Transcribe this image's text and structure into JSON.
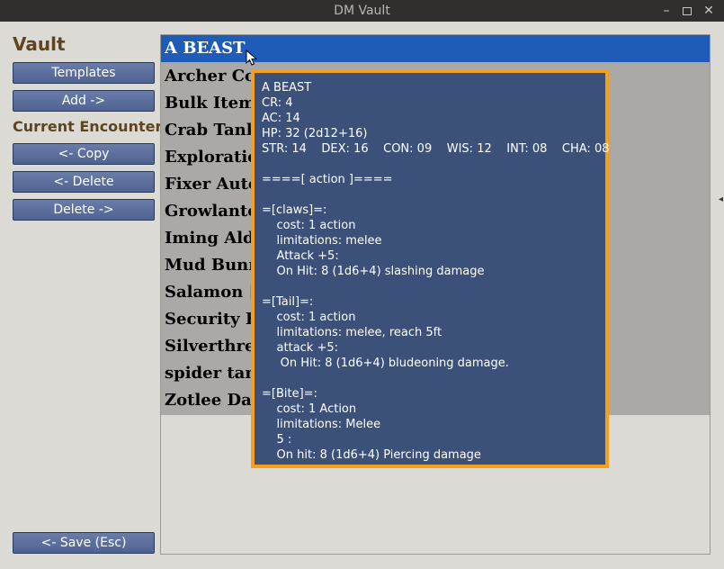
{
  "window": {
    "title": "DM Vault"
  },
  "sidebar": {
    "title": "Vault",
    "templates_label": "Templates",
    "add_label": "Add ->",
    "encounter_title": "Current Encounter",
    "copy_label": "<- Copy",
    "delete_left_label": "<- Delete",
    "delete_right_label": "Delete ->",
    "save_label": "<- Save (Esc)"
  },
  "list": {
    "items": [
      {
        "label": "A BEAST"
      },
      {
        "label": "Archer Co"
      },
      {
        "label": "Bulk Items"
      },
      {
        "label": "Crab Tank"
      },
      {
        "label": "Exploratio"
      },
      {
        "label": "Fixer Auto"
      },
      {
        "label": "Growlante"
      },
      {
        "label": "Iming Alda"
      },
      {
        "label": "Mud Bunn"
      },
      {
        "label": "Salamon [I"
      },
      {
        "label": "Security B"
      },
      {
        "label": "Silverthrea"
      },
      {
        "label": "spider tank"
      },
      {
        "label": "Zotlee Dak"
      }
    ],
    "selected_index": 0
  },
  "tooltip": {
    "lines": [
      "A BEAST",
      "CR: 4",
      "AC: 14",
      "HP: 32 (2d12+16)",
      "STR: 14    DEX: 16    CON: 09    WIS: 12    INT: 08    CHA: 08",
      "",
      "====[ action ]====",
      "",
      "=[claws]=:",
      "    cost: 1 action",
      "    limitations: melee",
      "    Attack +5:",
      "    On Hit: 8 (1d6+4) slashing damage",
      "",
      "=[Tail]=:",
      "    cost: 1 action",
      "    limitations: melee, reach 5ft",
      "    attack +5:",
      "     On Hit: 8 (1d6+4) bludeoning damage.",
      "",
      "=[Bite]=:",
      "    cost: 1 Action",
      "    limitations: Melee",
      "    5 :",
      "    On hit: 8 (1d6+4) Piercing damage"
    ]
  },
  "colors": {
    "accent_button": "#5a6d9c",
    "selection": "#1f5cb8",
    "tooltip_bg": "#3b5179",
    "tooltip_border": "#f5a01a",
    "heading": "#5e4520"
  },
  "icons": {
    "cursor": "mouse-pointer-icon"
  }
}
